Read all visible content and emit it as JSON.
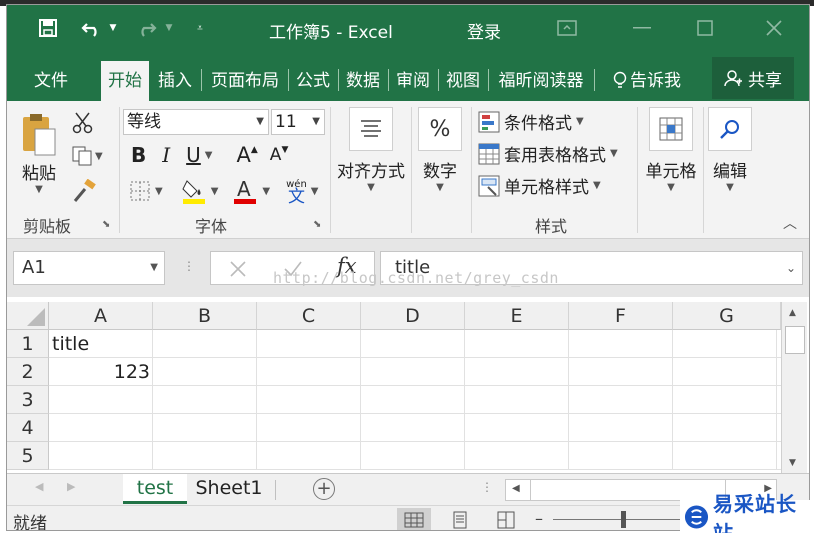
{
  "window": {
    "title": "工作簿5  -  Excel",
    "signin": "登录"
  },
  "tabs": [
    {
      "label": "文件"
    },
    {
      "label": "开始"
    },
    {
      "label": "插入"
    },
    {
      "label": "页面布局"
    },
    {
      "label": "公式"
    },
    {
      "label": "数据"
    },
    {
      "label": "审阅"
    },
    {
      "label": "视图"
    },
    {
      "label": "福昕阅读器"
    }
  ],
  "tellme": "告诉我",
  "share": "共享",
  "ribbon": {
    "paste": "粘贴",
    "clipboard": "剪贴板",
    "font_name": "等线",
    "font_size": "11",
    "font_group": "字体",
    "bold": "B",
    "italic": "I",
    "underline": "U",
    "grow": "A",
    "shrink": "A",
    "phonetic_top": "wén",
    "phonetic_char": "文",
    "align": "对齐方式",
    "number": "数字",
    "cond_format": "条件格式",
    "table_format": "套用表格格式",
    "cell_style": "单元格样式",
    "styles": "样式",
    "cells": "单元格",
    "editing": "编辑"
  },
  "formula": {
    "namebox": "A1",
    "value": "title",
    "fx": "fx"
  },
  "watermark": "http://blog.csdn.net/grey_csdn",
  "grid": {
    "columns": [
      "A",
      "B",
      "C",
      "D",
      "E",
      "F",
      "G"
    ],
    "rows": [
      "1",
      "2",
      "3",
      "4",
      "5"
    ],
    "a1": "title",
    "a2": "123"
  },
  "sheets": {
    "active": "test",
    "other": "Sheet1"
  },
  "status": "就绪",
  "logo": "易采站长站",
  "colors": {
    "accent": "#217346"
  }
}
